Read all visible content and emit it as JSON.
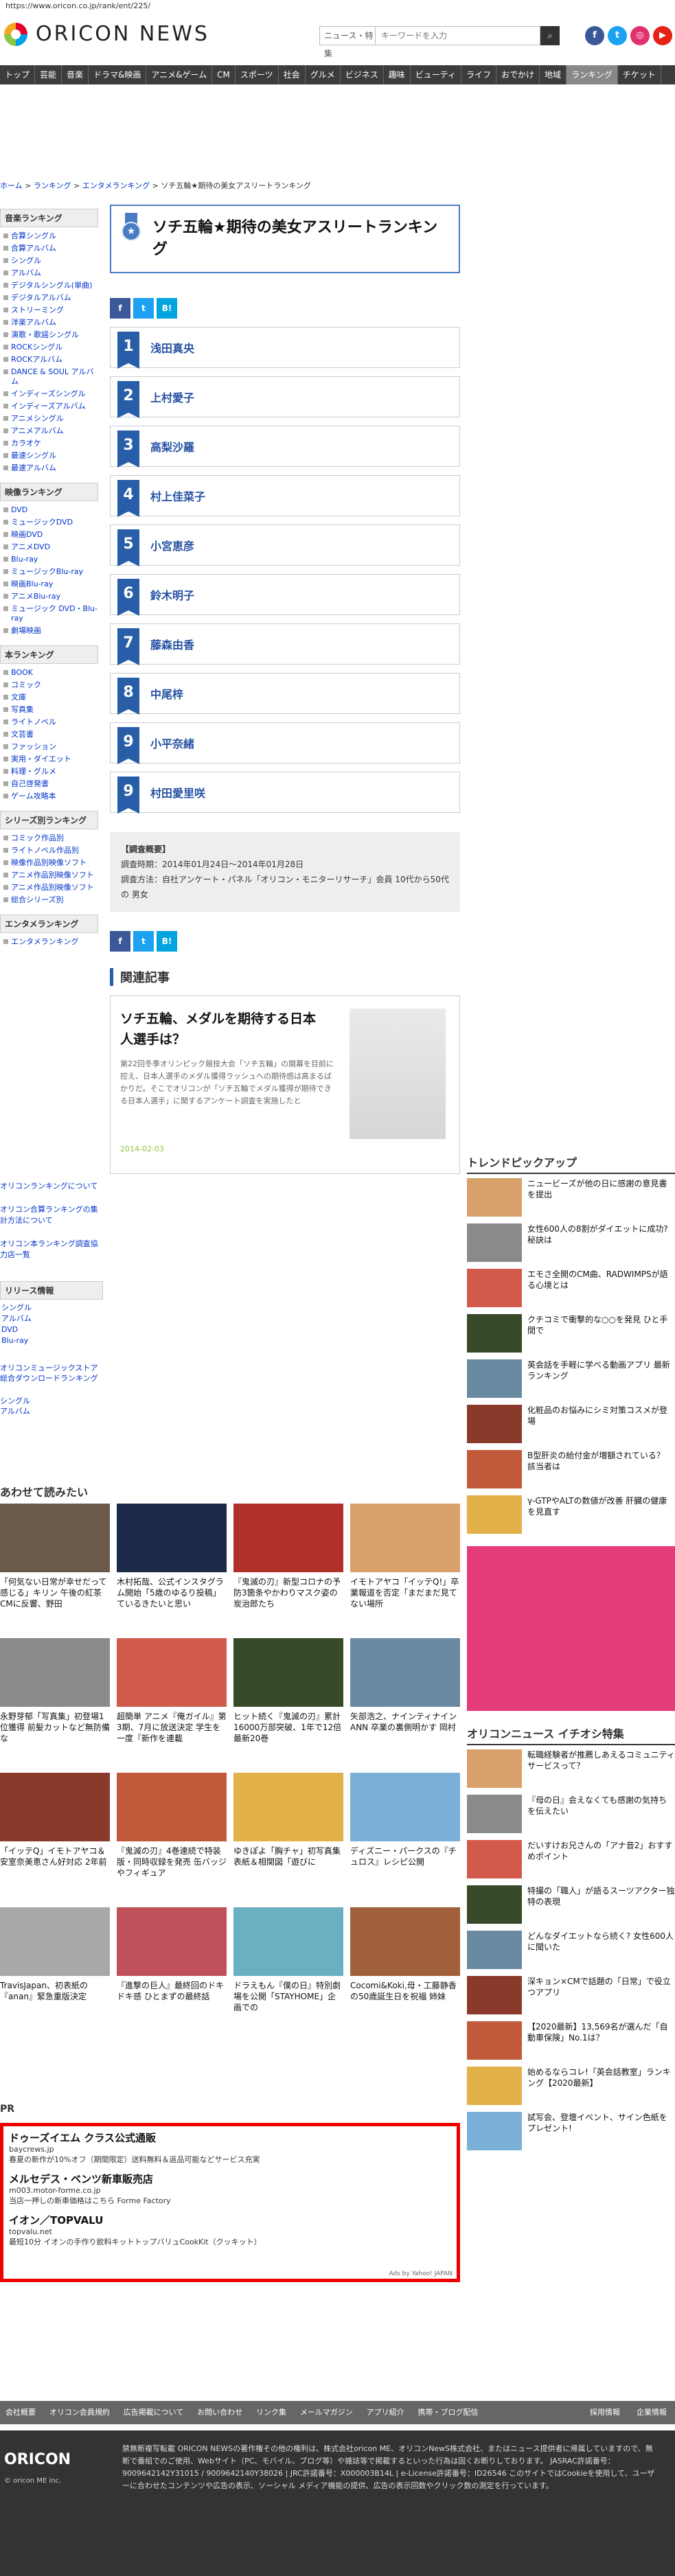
{
  "browser": {
    "url": "https://www.oricon.co.jp/rank/ent/225/"
  },
  "header": {
    "brand": "ORICON NEWS",
    "search_select": "ニュース・特集",
    "search_placeholder": "キーワードを入力",
    "search_icon": "search-icon"
  },
  "nav": [
    "トップ",
    "芸能",
    "音楽",
    "ドラマ&映画",
    "アニメ&ゲーム",
    "CM",
    "スポーツ",
    "社会",
    "グルメ",
    "ビジネス",
    "趣味",
    "ビューティ",
    "ライフ",
    "おでかけ",
    "地域",
    "ランキング",
    "チケット"
  ],
  "breadcrumb": {
    "home": "ホーム",
    "ranking": "ランキング",
    "ent": "エンタメランキング",
    "current": "ソチ五輪★期待の美女アスリートランキング"
  },
  "sidebar": {
    "music_head": "音楽ランキング",
    "music": [
      "合算シングル",
      "合算アルバム",
      "シングル",
      "アルバム",
      "デジタルシングル(単曲)",
      "デジタルアルバム",
      "ストリーミング",
      "洋楽アルバム",
      "演歌・歌謡シングル",
      "ROCKシングル",
      "ROCKアルバム",
      "DANCE & SOUL アルバム",
      "インディーズシングル",
      "インディーズアルバム",
      "アニメシングル",
      "アニメアルバム",
      "カラオケ",
      "最速シングル",
      "最速アルバム"
    ],
    "video_head": "映像ランキング",
    "video": [
      "DVD",
      "ミュージックDVD",
      "映画DVD",
      "アニメDVD",
      "Blu-ray",
      "ミュージックBlu-ray",
      "映画Blu-ray",
      "アニメBlu-ray",
      "ミュージック DVD・Blu-ray",
      "劇場映画"
    ],
    "book_head": "本ランキング",
    "book": [
      "BOOK",
      "コミック",
      "文庫",
      "写真集",
      "ライトノベル",
      "文芸書",
      "ファッション",
      "実用・ダイエット",
      "料理・グルメ",
      "自己啓発書",
      "ゲーム攻略本"
    ],
    "series_head": "シリーズ別ランキング",
    "series": [
      "コミック作品別",
      "ライトノベル作品別",
      "映像作品別映像ソフト",
      "アニメ作品別映像ソフト",
      "アニメ作品別映像ソフト",
      "総合シリーズ別"
    ],
    "ent_head": "エンタメランキング",
    "ent": [
      "エンタメランキング"
    ]
  },
  "main": {
    "title": "ソチ五輪★期待の美女アスリートランキング",
    "medal_icon": "medal-icon",
    "ranking": [
      {
        "rank": "1",
        "name": "浅田真央"
      },
      {
        "rank": "2",
        "name": "上村愛子"
      },
      {
        "rank": "3",
        "name": "高梨沙羅"
      },
      {
        "rank": "4",
        "name": "村上佳菜子"
      },
      {
        "rank": "5",
        "name": "小宮恵彦"
      },
      {
        "rank": "6",
        "name": "鈴木明子"
      },
      {
        "rank": "7",
        "name": "藤森由香"
      },
      {
        "rank": "8",
        "name": "中尾梓"
      },
      {
        "rank": "9",
        "name": "小平奈緒"
      },
      {
        "rank": "9",
        "name": "村田愛里咲"
      }
    ],
    "survey": {
      "head": "【調査概要】",
      "period": "調査時期：2014年01月24日～2014年01月28日",
      "method": "調査方法：自社アンケート・パネル「オリコン・モニターリサーチ」会員 10代から50代 の 男女"
    },
    "related_head": "関連記事",
    "related": {
      "title": "ソチ五輪、メダルを期待する日本人選手は？",
      "body": "第22回冬季オリンピック競技大会「ソチ五輪」の開幕を目前に控え、日本人選手のメダル獲得ラッシュへの期待感は高まるばかりだ。そこでオリコンが「ソチ五輪でメダル獲得が期待できる日本人選手」に関するアンケート調査を実施したと",
      "date": "2014-02-03"
    }
  },
  "lower_links": [
    "オリコンランキングについて",
    "オリコン合算ランキングの集計方法について",
    "オリコン本ランキング調査協力店一覧"
  ],
  "release_head": "リリース情報",
  "release": [
    "シングル",
    "アルバム",
    "DVD",
    "Blu-ray"
  ],
  "digital": [
    "オリコンミュージックストア総合ダウンロードランキング",
    "シングル",
    "アルバム"
  ],
  "recommend": {
    "head": "あわせて読みたい",
    "items": [
      "「何気ない日常が幸せだって感じる」キリン 午後の紅茶CMに反響、野田",
      "木村拓哉、公式インスタグラム開始「5歳のゆるり投稿」ているきたいと思い",
      "『鬼滅の刃』新型コロナの予防3箇条やかわりマスク姿の炭治郎たち",
      "イモトアヤコ「イッテQ!」卒業報道を否定「まだまだ見てない場所",
      "永野芽郁「写真集」初登場1位獲得 前髪カットなど無防備な",
      "超簡単 アニメ『俺ガイル』第3期、7月に放送決定 学生を一度『新作を連載",
      "ヒット続く『鬼滅の刃』累計16000万部突破、1年で12倍 最新20巻",
      "矢部浩之、ナインティナイン ANN 卒業の裏側明かす 岡村",
      "「イッテQ」イモトアヤコ＆安室奈美恵さん好対応 2年前",
      "『鬼滅の刃』4巻連続で特装版・同時収録を発売 缶バッジやフィギュア",
      "ゆきぽよ「胸チャ」初写真集 表紙＆相関図「遊びに",
      "ディズニー・パークスの『チュロス』レシピ公開",
      "TravisJapan、初表紙の『anan』緊急重版決定",
      "『進撃の巨人』最終回のドキドキ感 ひとまずの最終話",
      "ドラえもん『僕の日』特別劇場を公開「STAYHOME」企画での",
      "Cocomi&Koki,母・工藤静香の50歳誕生日を祝福 姉妹"
    ]
  },
  "trend": {
    "head": "トレンドピックアップ",
    "items": [
      "ニュービーズが他の日に感謝の意見書を提出",
      "女性600人の8割がダイエットに成功?秘訣は",
      "エモさ全開のCM曲、RADWIMPSが語る心境とは",
      "クチコミで衝撃的な○○を発見 ひと手間で",
      "英会話を手軽に学べる動画アプリ 最新ランキング",
      "化粧品のお悩みにシミ対策コスメが登場",
      "B型肝炎の給付金が増額されている？ 該当者は",
      "γ-GTPやALTの数値が改善 肝臓の健康を見直す"
    ],
    "sub_head": "オリコンニュース イチオシ特集",
    "sub_items": [
      "転職経験者が推薦しあえるコミュニティサービスって？",
      "『母の日』会えなくても感謝の気持ちを伝えたい",
      "だいすけお兄さんの「アナ音2」おすすめポイント",
      "特撮の「職人」が語るスーツアクター独特の表現",
      "どんなダイエットなら続く? 女性600人に聞いた",
      "深キョン×CMで話題の「日常」で役立つアプリ",
      "【2020最新】13,569名が選んだ「自動車保険」No.1は？",
      "始めるならコレ!「英会話教室」ランキング【2020最新】",
      "試写会、登壇イベント、サイン色紙をプレゼント!"
    ]
  },
  "pr": {
    "label": "PR",
    "items": [
      {
        "title": "ドゥーズイエム クラス公式通販",
        "url": "baycrews.jp",
        "desc": "春夏の新作が10%オフ（期間限定）送料無料＆返品可能などサービス充実"
      },
      {
        "title": "メルセデス・ベンツ新車販売店",
        "url": "m003.motor-forme.co.jp",
        "desc": "当店一押しの新車価格はこちら Forme Factory"
      },
      {
        "title": "イオン／TOPVALU",
        "url": "topvalu.net",
        "desc": "最短10分 イオンの手作り飲料キットトップバリュCookKit（クッキット）"
      }
    ],
    "ads_by": "Ads by Yahoo! JAPAN"
  },
  "footer": {
    "links": [
      "会社概要",
      "オリコン会員規約",
      "広告掲載について",
      "お問い合わせ",
      "リンク集",
      "メールマガジン",
      "アプリ紹介",
      "携帯・ブログ配信"
    ],
    "right_links": [
      "採用情報",
      "企業情報"
    ],
    "brand": "ORICON",
    "copy": "© oricon ME inc.",
    "text": "禁無断複写転載 ORICON NEWSの著作権その他の権利は、株式会社oricon ME、オリコンNewS株式会社、またはニュース提供者に帰属していますので、無断で番組でのご使用、Webサイト（PC、モバイル、ブログ等）や雑誌等で掲載するといった行為は固くお断りしております。 JASRAC許諾番号：9009642142Y31015 / 9009642140Y38026 | JRC許諾番号：X000003B14L | e-License許諾番号：ID26546 このサイトではCookieを使用して、ユーザーに合わせたコンテンツや広告の表示、ソーシャル メディア機能の提供、広告の表示回数やクリック数の測定を行っています。"
  }
}
